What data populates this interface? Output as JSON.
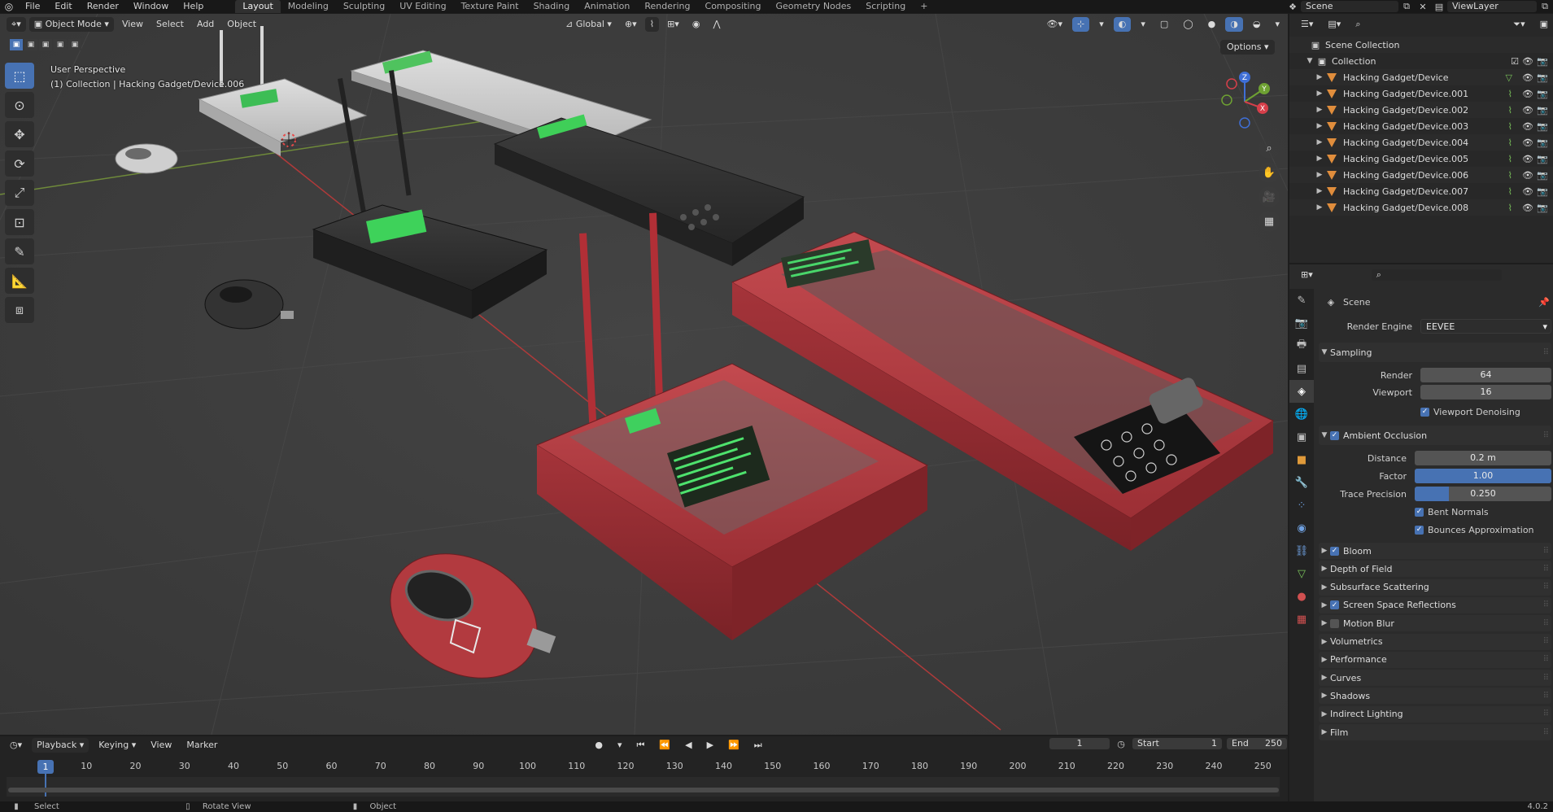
{
  "topbar": {
    "menus": [
      "File",
      "Edit",
      "Render",
      "Window",
      "Help"
    ],
    "workspaces": [
      "Layout",
      "Modeling",
      "Sculpting",
      "UV Editing",
      "Texture Paint",
      "Shading",
      "Animation",
      "Rendering",
      "Compositing",
      "Geometry Nodes",
      "Scripting"
    ],
    "active_workspace": "Layout",
    "scene": "Scene",
    "view_layer": "ViewLayer"
  },
  "viewport": {
    "mode": "Object Mode",
    "menus": [
      "View",
      "Select",
      "Add",
      "Object"
    ],
    "orientation": "Global",
    "options_label": "Options",
    "perspective_label": "User Perspective",
    "context_label": "(1) Collection | Hacking Gadget/Device.006",
    "gizmo_axes": {
      "x": "X",
      "y": "Y",
      "z": "Z"
    }
  },
  "timeline": {
    "menus": [
      "Playback",
      "Keying",
      "View",
      "Marker"
    ],
    "current_frame": "1",
    "start_label": "Start",
    "start": "1",
    "end_label": "End",
    "end": "250",
    "ticks": [
      "10",
      "20",
      "30",
      "40",
      "50",
      "60",
      "70",
      "80",
      "90",
      "100",
      "110",
      "120",
      "130",
      "140",
      "150",
      "160",
      "170",
      "180",
      "190",
      "200",
      "210",
      "220",
      "230",
      "240",
      "250"
    ],
    "playhead": "1"
  },
  "statusbar": {
    "select": "Select",
    "rotate": "Rotate View",
    "object": "Object",
    "version": "4.0.2"
  },
  "outliner": {
    "scene_collection": "Scene Collection",
    "collection": "Collection",
    "items": [
      "Hacking Gadget/Device",
      "Hacking Gadget/Device.001",
      "Hacking Gadget/Device.002",
      "Hacking Gadget/Device.003",
      "Hacking Gadget/Device.004",
      "Hacking Gadget/Device.005",
      "Hacking Gadget/Device.006",
      "Hacking Gadget/Device.007",
      "Hacking Gadget/Device.008"
    ]
  },
  "properties": {
    "context": "Scene",
    "render_engine_label": "Render Engine",
    "render_engine": "EEVEE",
    "sampling": {
      "title": "Sampling",
      "render_label": "Render",
      "render": "64",
      "viewport_label": "Viewport",
      "viewport": "16",
      "denoise_label": "Viewport Denoising"
    },
    "ao": {
      "title": "Ambient Occlusion",
      "distance_label": "Distance",
      "distance": "0.2 m",
      "factor_label": "Factor",
      "factor": "1.00",
      "factor_fill": 1.0,
      "trace_label": "Trace Precision",
      "trace": "0.250",
      "trace_fill": 0.25,
      "bent_label": "Bent Normals",
      "bounces_label": "Bounces Approximation"
    },
    "panels": [
      "Bloom",
      "Depth of Field",
      "Subsurface Scattering",
      "Screen Space Reflections",
      "Motion Blur",
      "Volumetrics",
      "Performance",
      "Curves",
      "Shadows",
      "Indirect Lighting",
      "Film"
    ]
  },
  "colors": {
    "accent": "#4772b3",
    "mesh": "#e08d3c",
    "device_red": "#b23a3f",
    "device_dark": "#2b2b2b",
    "device_white": "#c9c9c9",
    "screen_green": "#36d65a"
  }
}
